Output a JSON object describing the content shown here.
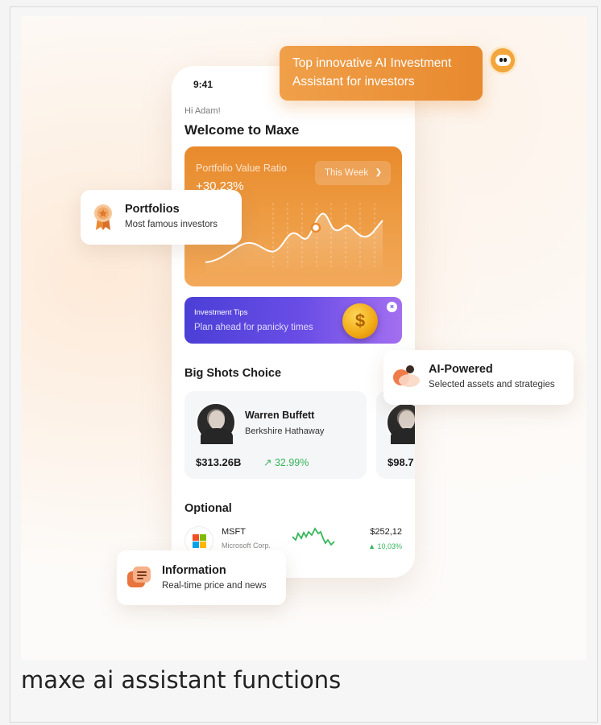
{
  "caption": "maxe ai assistant functions",
  "phone": {
    "time": "9:41",
    "greeting": "Hi Adam!",
    "welcome": "Welcome to Maxe",
    "portfolio": {
      "label": "Portfolio Value Ratio",
      "value": "+30.23%",
      "period": "This Week"
    },
    "tips": {
      "title": "Investment Tips",
      "text": "Plan ahead for panicky times",
      "coin_symbol": "$"
    },
    "big_shots": {
      "title": "Big Shots Choice",
      "cards": [
        {
          "name": "Warren Buffett",
          "company": "Berkshire Hathaway",
          "value": "$313.26B",
          "change": "↗ 32.99%"
        },
        {
          "name": "",
          "company": "",
          "value": "$98.7",
          "change": ""
        }
      ]
    },
    "optional": {
      "title": "Optional",
      "stocks": [
        {
          "ticker": "MSFT",
          "name": "Microsoft Corp.",
          "price": "$252,12",
          "change": "▲ 10,03%"
        }
      ]
    }
  },
  "floating": {
    "ai_bubble": "Top innovative AI Investment Assistant for investors",
    "portfolios": {
      "title": "Portfolios",
      "subtitle": "Most famous investors"
    },
    "ai_powered": {
      "title": "AI-Powered",
      "subtitle": "Selected assets and strategies"
    },
    "information": {
      "title": "Information",
      "subtitle": "Real-time price and news"
    }
  },
  "colors": {
    "accent_orange": "#e88a2c",
    "tips_purple": "#5b46e0",
    "positive_green": "#34b659"
  }
}
